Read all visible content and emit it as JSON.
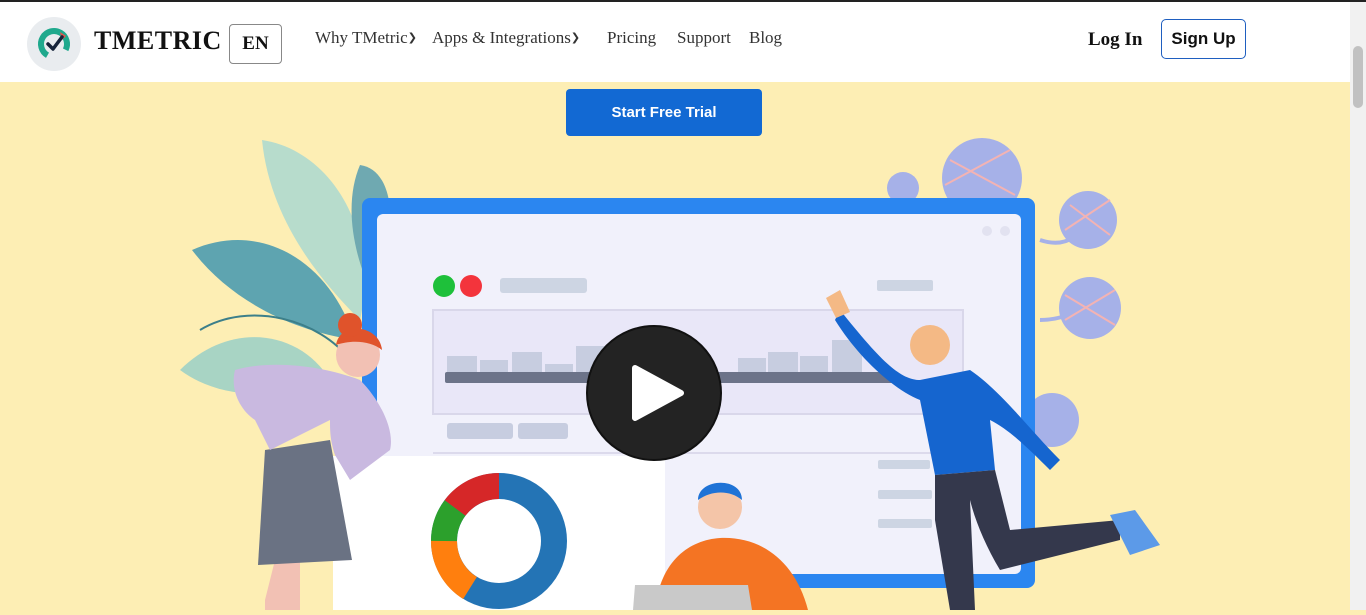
{
  "header": {
    "brand": "TMETRIC",
    "lang": "EN",
    "nav": [
      {
        "label": "Why TMetric",
        "dropdown": true
      },
      {
        "label": "Apps & Integrations",
        "dropdown": true
      },
      {
        "label": "Pricing",
        "dropdown": false
      },
      {
        "label": "Support",
        "dropdown": false
      },
      {
        "label": "Blog",
        "dropdown": false
      }
    ],
    "login_label": "Log In",
    "signup_label": "Sign Up"
  },
  "hero": {
    "cta_label": "Start Free Trial",
    "video_icon": "play-icon"
  },
  "colors": {
    "page_bg": "#fdeeb4",
    "accent": "#1269d3",
    "frame_blue": "#2b86f0",
    "play_button": "#232323"
  }
}
